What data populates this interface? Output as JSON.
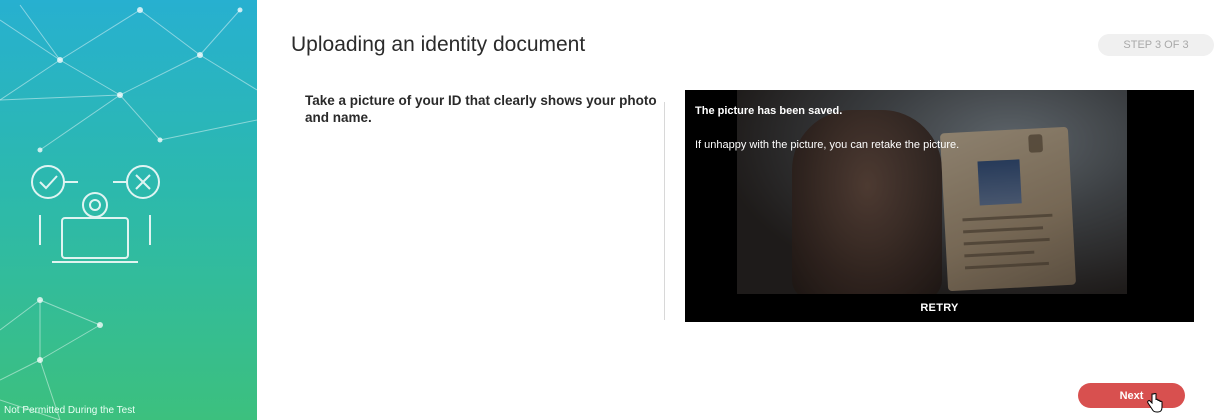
{
  "sidebar": {
    "footer_text": "Not Permitted During the Test",
    "illustration_icon": "laptop-gear-check-cross-icon",
    "gradient_colors": [
      "#27b0d0",
      "#2cb9ad",
      "#3cc07e"
    ]
  },
  "header": {
    "title": "Uploading an identity document",
    "step_label": "STEP 3 OF 3"
  },
  "main": {
    "instructions": "Take a picture of your ID that clearly shows your photo and name.",
    "camera": {
      "saved_message": "The picture has been saved.",
      "retake_message": "If unhappy with the picture, you can retake the picture.",
      "retry_label": "RETRY"
    },
    "next_label": "Next"
  },
  "colors": {
    "accent": "#d8504f",
    "badge_bg": "#f0f0f0",
    "badge_text": "#a9a9a9"
  }
}
